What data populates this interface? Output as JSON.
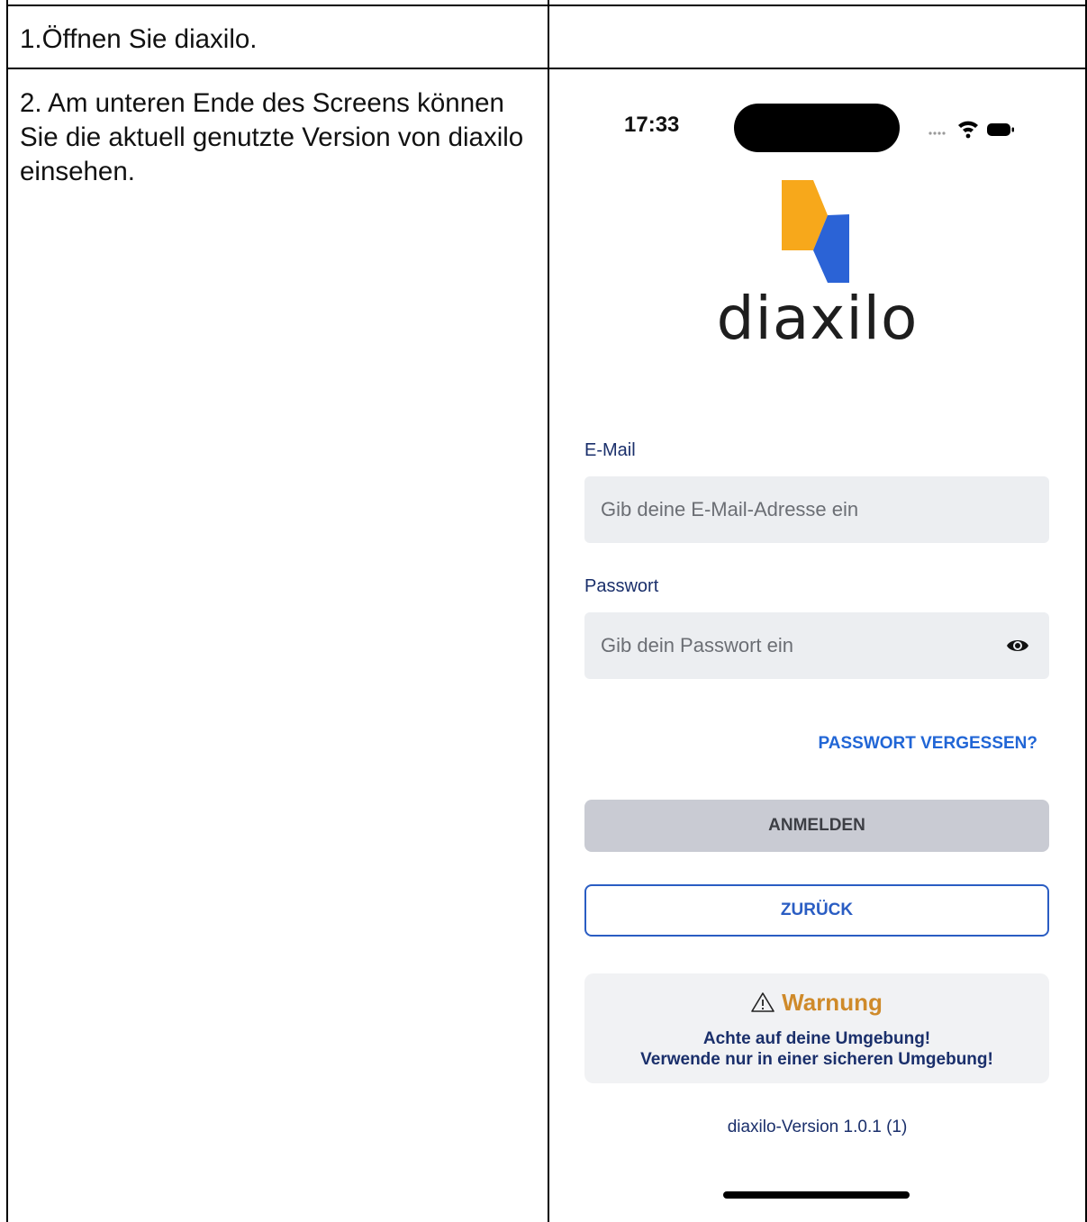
{
  "document": {
    "rows": [
      {
        "step": "1.Öffnen Sie diaxilo."
      },
      {
        "step": "2. Am unteren Ende des Screens können Sie die aktuell genutzte Version von diaxilo einsehen."
      }
    ]
  },
  "phone": {
    "status_time": "17:33",
    "icons": [
      "signal-dots-icon",
      "wifi-icon",
      "battery-icon"
    ],
    "brand_name": "diaxilo",
    "email": {
      "label": "E-Mail",
      "placeholder": "Gib deine E-Mail-Adresse ein"
    },
    "password": {
      "label": "Passwort",
      "placeholder": "Gib dein Passwort ein",
      "icon": "eye-icon"
    },
    "forgot_link": "PASSWORT VERGESSEN?",
    "login_button": "ANMELDEN",
    "back_button": "ZURÜCK",
    "warning": {
      "title": "Warnung",
      "line1": "Achte auf deine Umgebung!",
      "line2": "Verwende nur in einer sicheren Umgebung!"
    },
    "version": "diaxilo-Version 1.0.1 (1)",
    "colors": {
      "logo_yellow": "#f7a81b",
      "logo_blue": "#2b63d6",
      "label_navy": "#1a2f6b",
      "link_blue": "#2166d6",
      "warning_orange": "#cf8a2a"
    }
  }
}
